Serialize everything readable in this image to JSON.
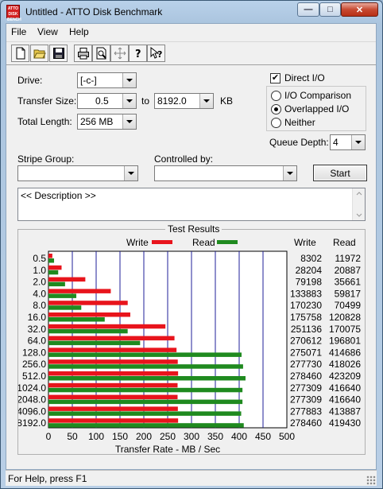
{
  "window": {
    "title": "Untitled - ATTO Disk Benchmark",
    "icon_text": "ATTO DISK BENCH",
    "minimize_icon": "minimize-icon",
    "maximize_icon": "maximize-icon",
    "close_icon": "close-icon"
  },
  "menu": {
    "items": [
      "File",
      "View",
      "Help"
    ]
  },
  "toolbar": {
    "icons": [
      "new-file-icon",
      "open-folder-icon",
      "save-icon",
      "print-icon",
      "print-preview-icon",
      "move-icon",
      "help-icon",
      "context-help-icon"
    ]
  },
  "form": {
    "drive_label": "Drive:",
    "drive_value": "[-c-]",
    "transfer_size_label": "Transfer Size:",
    "transfer_from": "0.5",
    "to_label": "to",
    "transfer_to": "8192.0",
    "kb_label": "KB",
    "total_length_label": "Total Length:",
    "total_length_value": "256 MB",
    "stripe_group_label": "Stripe Group:",
    "stripe_group_value": "",
    "controlled_by_label": "Controlled by:",
    "controlled_by_value": "",
    "start_label": "Start",
    "description": "<< Description >>"
  },
  "options": {
    "direct_io_label": "Direct I/O",
    "direct_io_checked": true,
    "io_comparison_label": "I/O Comparison",
    "overlapped_io_label": "Overlapped I/O",
    "neither_label": "Neither",
    "selected_mode": "Overlapped I/O",
    "queue_depth_label": "Queue Depth:",
    "queue_depth_value": "4"
  },
  "results": {
    "title": "Test Results",
    "write_legend": "Write",
    "read_legend": "Read",
    "write_col": "Write",
    "read_col": "Read",
    "rows": [
      {
        "size": "0.5",
        "write": "8302",
        "read": "11972"
      },
      {
        "size": "1.0",
        "write": "28204",
        "read": "20887"
      },
      {
        "size": "2.0",
        "write": "79198",
        "read": "35661"
      },
      {
        "size": "4.0",
        "write": "133883",
        "read": "59817"
      },
      {
        "size": "8.0",
        "write": "170230",
        "read": "70499"
      },
      {
        "size": "16.0",
        "write": "175758",
        "read": "120828"
      },
      {
        "size": "32.0",
        "write": "251136",
        "read": "170075"
      },
      {
        "size": "64.0",
        "write": "270612",
        "read": "196801"
      },
      {
        "size": "128.0",
        "write": "275071",
        "read": "414686"
      },
      {
        "size": "256.0",
        "write": "277730",
        "read": "418026"
      },
      {
        "size": "512.0",
        "write": "278460",
        "read": "423209"
      },
      {
        "size": "1024.0",
        "write": "277309",
        "read": "416640"
      },
      {
        "size": "2048.0",
        "write": "277309",
        "read": "416640"
      },
      {
        "size": "4096.0",
        "write": "277883",
        "read": "413887"
      },
      {
        "size": "8192.0",
        "write": "278460",
        "read": "419430"
      }
    ]
  },
  "chart_data": {
    "type": "bar",
    "orientation": "horizontal",
    "categories": [
      "0.5",
      "1.0",
      "2.0",
      "4.0",
      "8.0",
      "16.0",
      "32.0",
      "64.0",
      "128.0",
      "256.0",
      "512.0",
      "1024.0",
      "2048.0",
      "4096.0",
      "8192.0"
    ],
    "series": [
      {
        "name": "Write",
        "color": "#e8141c",
        "values": [
          8.1,
          27.5,
          77.3,
          130.7,
          166.2,
          171.6,
          245.3,
          264.3,
          268.6,
          271.2,
          271.9,
          270.8,
          270.8,
          271.4,
          271.9
        ]
      },
      {
        "name": "Read",
        "color": "#1f8a1f",
        "values": [
          11.7,
          20.4,
          34.8,
          58.4,
          68.8,
          118.0,
          166.1,
          192.2,
          405.0,
          408.2,
          413.3,
          406.9,
          406.9,
          404.2,
          409.6
        ]
      }
    ],
    "xlabel": "Transfer Rate - MB / Sec",
    "ylabel": "",
    "xlim": [
      0,
      500
    ],
    "xticks": [
      "0",
      "50",
      "100",
      "150",
      "200",
      "250",
      "300",
      "350",
      "400",
      "450",
      "500"
    ],
    "grid": true,
    "legend": "top"
  },
  "status": {
    "text": "For Help, press F1"
  }
}
